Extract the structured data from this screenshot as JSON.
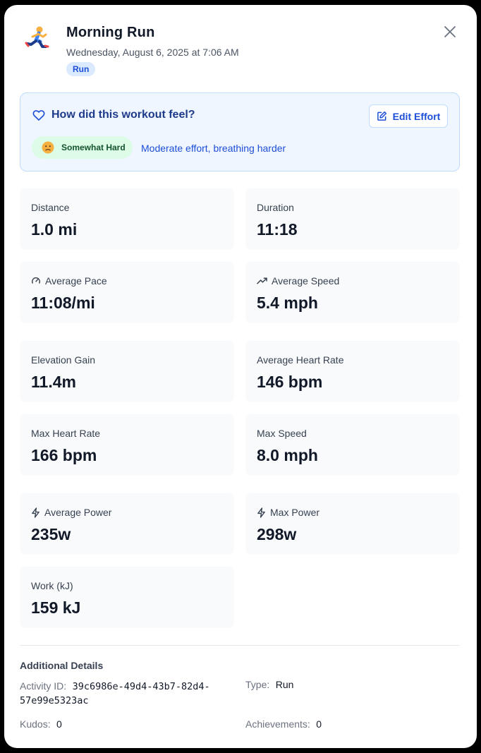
{
  "activity": {
    "title": "Morning Run",
    "datetime": "Wednesday, August 6, 2025 at 7:06 AM",
    "badge": "Run",
    "icon": "runner-icon"
  },
  "effort": {
    "question": "How did this workout feel?",
    "edit_label": "Edit Effort",
    "level": "Somewhat Hard",
    "level_emoji": "🙁",
    "description": "Moderate effort, breathing harder"
  },
  "stats": {
    "distance": {
      "label": "Distance",
      "value": "1.0 mi"
    },
    "duration": {
      "label": "Duration",
      "value": "11:18"
    },
    "avg_pace": {
      "label": "Average Pace",
      "value": "11:08/mi"
    },
    "avg_speed": {
      "label": "Average Speed",
      "value": "5.4 mph"
    },
    "elevation": {
      "label": "Elevation Gain",
      "value": "11.4m"
    },
    "avg_hr": {
      "label": "Average Heart Rate",
      "value": "146 bpm"
    },
    "max_hr": {
      "label": "Max Heart Rate",
      "value": "166 bpm"
    },
    "max_speed": {
      "label": "Max Speed",
      "value": "8.0 mph"
    },
    "avg_power": {
      "label": "Average Power",
      "value": "235w"
    },
    "max_power": {
      "label": "Max Power",
      "value": "298w"
    },
    "work": {
      "label": "Work (kJ)",
      "value": "159 kJ"
    }
  },
  "details": {
    "title": "Additional Details",
    "activity_id_label": "Activity ID:",
    "activity_id_line1": "39c6986e-49d4-43b7-82d4-",
    "activity_id_line2": "57e99e5323ac",
    "type_label": "Type:",
    "type_value": "Run",
    "kudos_label": "Kudos:",
    "kudos_value": "0",
    "achievements_label": "Achievements:",
    "achievements_value": "0"
  },
  "colors": {
    "accent": "#1d4ed8",
    "effort_bg": "#eff6ff",
    "pill_bg": "#dcfce7",
    "card_bg": "#f9fafb"
  }
}
